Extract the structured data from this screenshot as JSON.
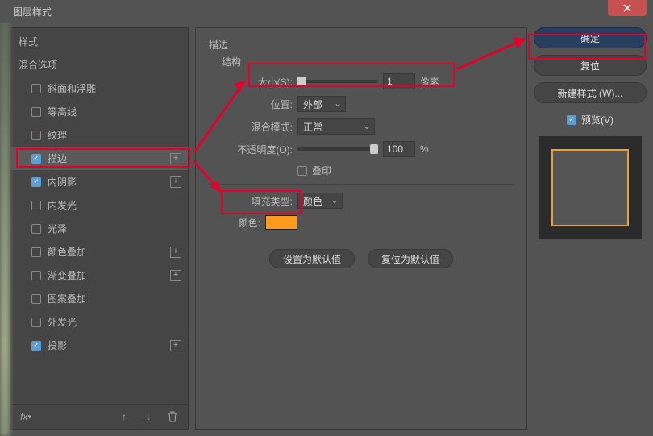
{
  "window": {
    "title": "图层样式"
  },
  "sidebar": {
    "styles_label": "样式",
    "blend_label": "混合选项",
    "items": [
      {
        "label": "斜面和浮雕",
        "checked": false,
        "plus": false
      },
      {
        "label": "等高线",
        "checked": false,
        "plus": false
      },
      {
        "label": "纹理",
        "checked": false,
        "plus": false
      },
      {
        "label": "描边",
        "checked": true,
        "plus": true,
        "active": true
      },
      {
        "label": "内阴影",
        "checked": true,
        "plus": true
      },
      {
        "label": "内发光",
        "checked": false,
        "plus": false
      },
      {
        "label": "光泽",
        "checked": false,
        "plus": false
      },
      {
        "label": "颜色叠加",
        "checked": false,
        "plus": true
      },
      {
        "label": "渐变叠加",
        "checked": false,
        "plus": true
      },
      {
        "label": "图案叠加",
        "checked": false,
        "plus": false
      },
      {
        "label": "外发光",
        "checked": false,
        "plus": false
      },
      {
        "label": "投影",
        "checked": true,
        "plus": true
      }
    ]
  },
  "main": {
    "group_title": "描边",
    "structure_title": "结构",
    "size_label": "大小(S):",
    "size_value": "1",
    "size_unit": "像素",
    "position_label": "位置:",
    "position_value": "外部",
    "blendmode_label": "混合模式:",
    "blendmode_value": "正常",
    "opacity_label": "不透明度(O):",
    "opacity_value": "100",
    "opacity_unit": "%",
    "overprint_label": "叠印",
    "filltype_label": "填充类型:",
    "filltype_value": "颜色",
    "color_label": "颜色:",
    "color_value": "#ff9a1f",
    "btn_default": "设置为默认值",
    "btn_reset": "复位为默认值"
  },
  "right": {
    "ok": "确定",
    "cancel": "复位",
    "newstyle": "新建样式 (W)...",
    "preview_label": "预览(V)",
    "preview_checked": true
  }
}
